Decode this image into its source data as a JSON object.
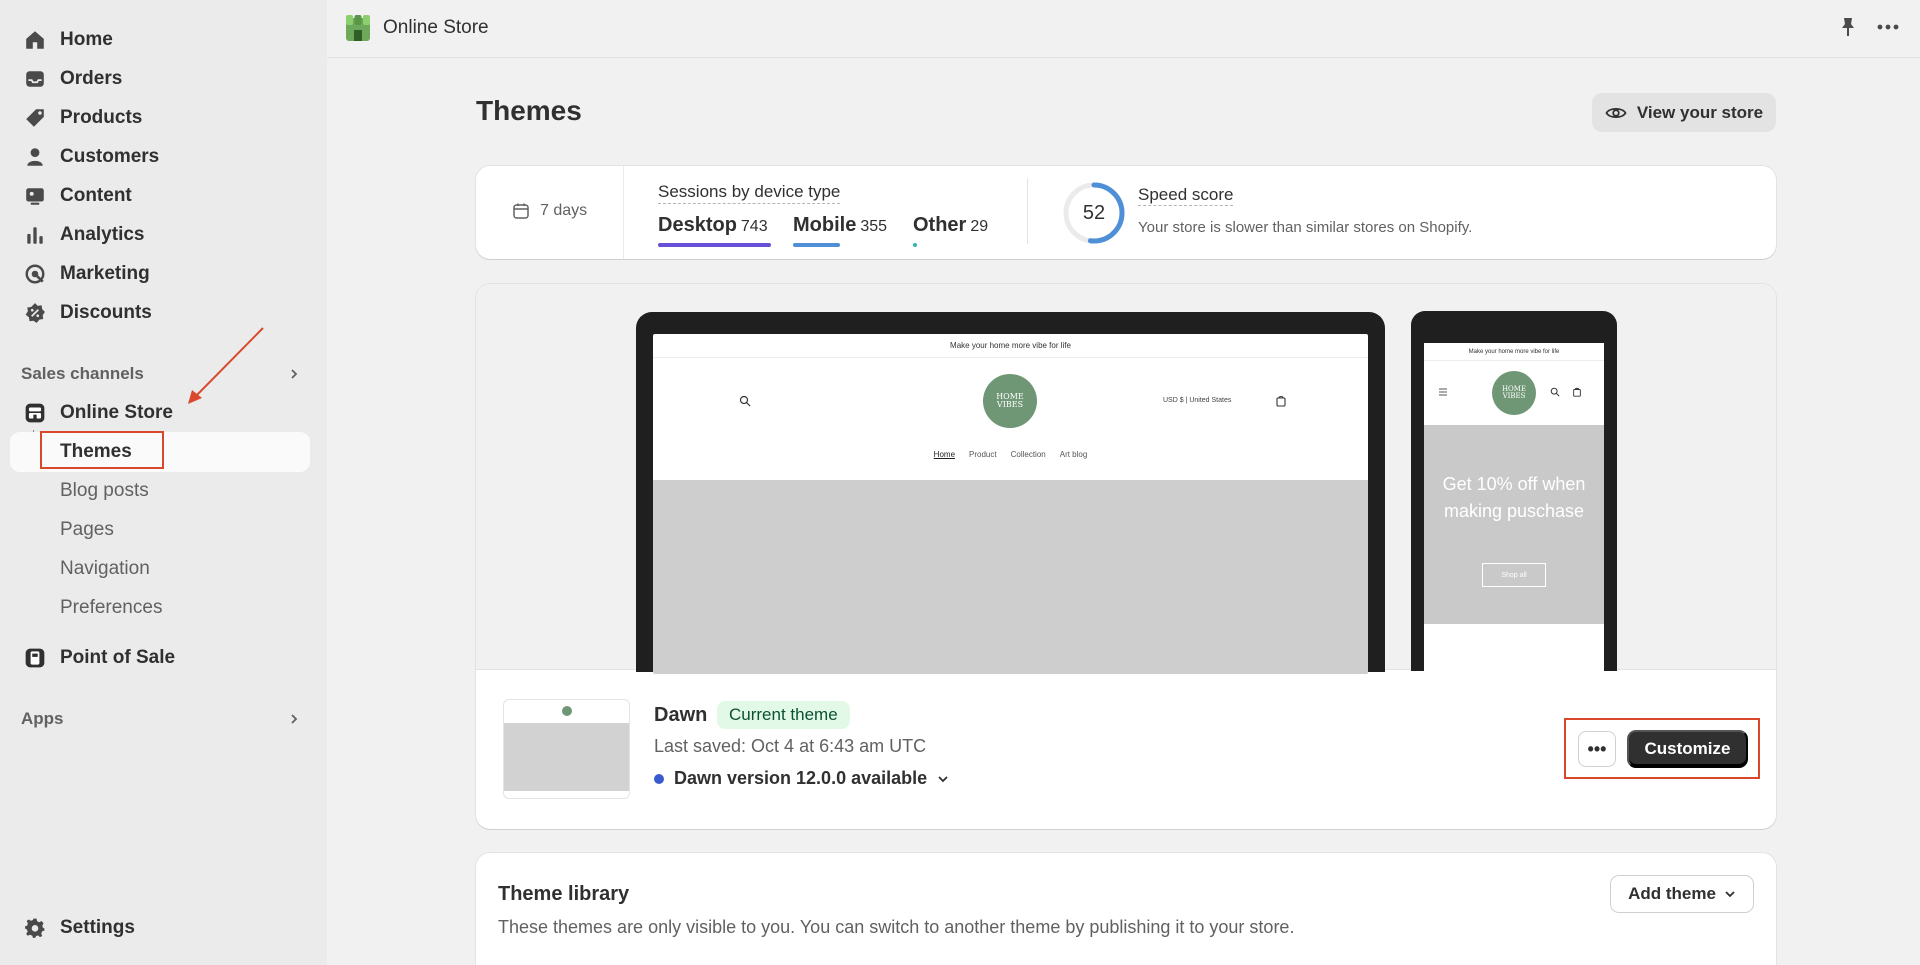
{
  "sidebar": {
    "items": [
      {
        "label": "Home",
        "icon": "home-icon"
      },
      {
        "label": "Orders",
        "icon": "inbox-icon"
      },
      {
        "label": "Products",
        "icon": "tag-icon"
      },
      {
        "label": "Customers",
        "icon": "person-icon"
      },
      {
        "label": "Content",
        "icon": "image-icon"
      },
      {
        "label": "Analytics",
        "icon": "bar-chart-icon"
      },
      {
        "label": "Marketing",
        "icon": "target-icon"
      },
      {
        "label": "Discounts",
        "icon": "discount-icon"
      }
    ],
    "sales_channels_label": "Sales channels",
    "online_store_label": "Online Store",
    "subitems": [
      "Themes",
      "Blog posts",
      "Pages",
      "Navigation",
      "Preferences"
    ],
    "point_of_sale_label": "Point of Sale",
    "apps_label": "Apps",
    "settings_label": "Settings"
  },
  "topbar": {
    "title": "Online Store"
  },
  "page": {
    "title": "Themes",
    "view_store_label": "View your store"
  },
  "stats": {
    "date_range": "7 days",
    "sessions_title": "Sessions by device type",
    "devices": [
      {
        "name": "Desktop",
        "count": "743",
        "color": "#6a4fd8"
      },
      {
        "name": "Mobile",
        "count": "355",
        "color": "#4f8fd8"
      },
      {
        "name": "Other",
        "count": "29",
        "color": "#2fb8a8"
      }
    ],
    "speed_score": "52",
    "speed_score_fraction": 0.52,
    "speed_title": "Speed score",
    "speed_desc": "Your store is slower than similar stores on Shopify."
  },
  "preview": {
    "announcement": "Make your home more vibe for life",
    "logo_text": "HOME VIBES",
    "currency": "USD $ | United States",
    "nav": [
      "Home",
      "Product",
      "Collection",
      "Art blog"
    ],
    "phone_hero_text": "Get 10% off when making puschase",
    "phone_button": "Shop all"
  },
  "current_theme": {
    "name": "Dawn",
    "badge": "Current theme",
    "last_saved": "Last saved: Oct 4 at 6:43 am UTC",
    "version": "Dawn version 12.0.0 available",
    "more_label": "•••",
    "customize_label": "Customize"
  },
  "library": {
    "title": "Theme library",
    "desc": "These themes are only visible to you. You can switch to another theme by publishing it to your store.",
    "add_label": "Add theme"
  },
  "colors": {
    "highlight": "#d9482b",
    "primary_button": "#303030",
    "badge_bg": "#e3f9e8",
    "speed_ring": "#4f8fd8"
  }
}
